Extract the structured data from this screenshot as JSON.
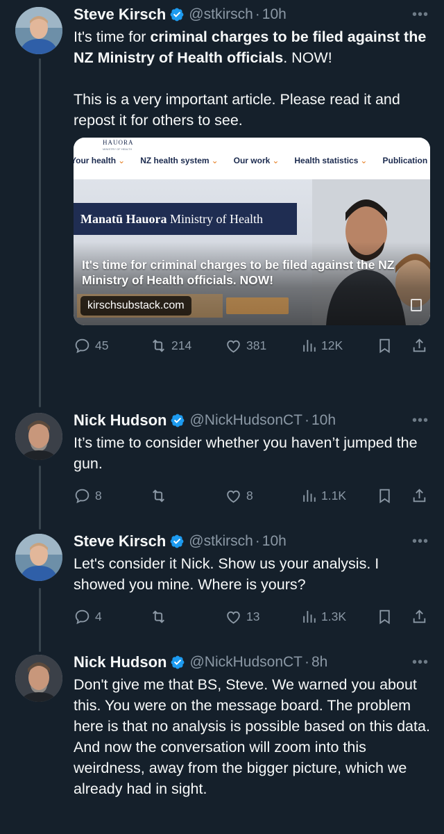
{
  "theme": {
    "background": "#15202b",
    "primary_text": "#f7f9f9",
    "secondary_text": "#8b98a5",
    "verified_color": "#1d9bf0",
    "thread_line": "#38444d"
  },
  "tweets": [
    {
      "name": "Steve Kirsch",
      "handle": "@stkirsch",
      "time": "10h",
      "text_plain_1": "It's time for ",
      "text_bold": "criminal charges to be filed against the NZ Ministry of Health officials",
      "text_plain_2": ". NOW!",
      "text_para2": "This is a very important article. Please read it and repost it for others to see.",
      "card": {
        "logo": "HAUORA",
        "logo_sub": "MINISTRY OF HEALTH",
        "nav": [
          "Your health",
          "NZ health system",
          "Our work",
          "Health statistics",
          "Publication"
        ],
        "banner_bold": "Manatū Hauora",
        "banner_rest": " Ministry of Health",
        "title": "It's time for criminal charges to be filed against the NZ Ministry of Health officials. NOW!",
        "domain": "kirschsubstack.com"
      },
      "stats": {
        "replies": "45",
        "reposts": "214",
        "likes": "381",
        "views": "12K"
      }
    },
    {
      "name": "Nick Hudson",
      "handle": "@NickHudsonCT",
      "time": "10h",
      "text": "It’s time to consider whether you haven’t jumped the gun.",
      "stats": {
        "replies": "8",
        "reposts": "",
        "likes": "8",
        "views": "1.1K"
      }
    },
    {
      "name": "Steve Kirsch",
      "handle": "@stkirsch",
      "time": "10h",
      "text": "Let's consider it Nick. Show us your analysis. I showed you mine. Where is yours?",
      "stats": {
        "replies": "4",
        "reposts": "",
        "likes": "13",
        "views": "1.3K"
      }
    },
    {
      "name": "Nick Hudson",
      "handle": "@NickHudsonCT",
      "time": "8h",
      "text": "Don't give me that BS, Steve. We warned you about this. You were on the message board. The problem here is that no analysis is possible based on this data. And now the conversation will zoom into this weirdness, away from the bigger picture, which we already had in sight."
    }
  ],
  "icons": {
    "reply": "reply-icon",
    "repost": "repost-icon",
    "like": "like-icon",
    "views": "views-icon",
    "bookmark": "bookmark-icon",
    "share": "share-icon",
    "more": "more-icon",
    "verified": "verified-badge-icon"
  }
}
